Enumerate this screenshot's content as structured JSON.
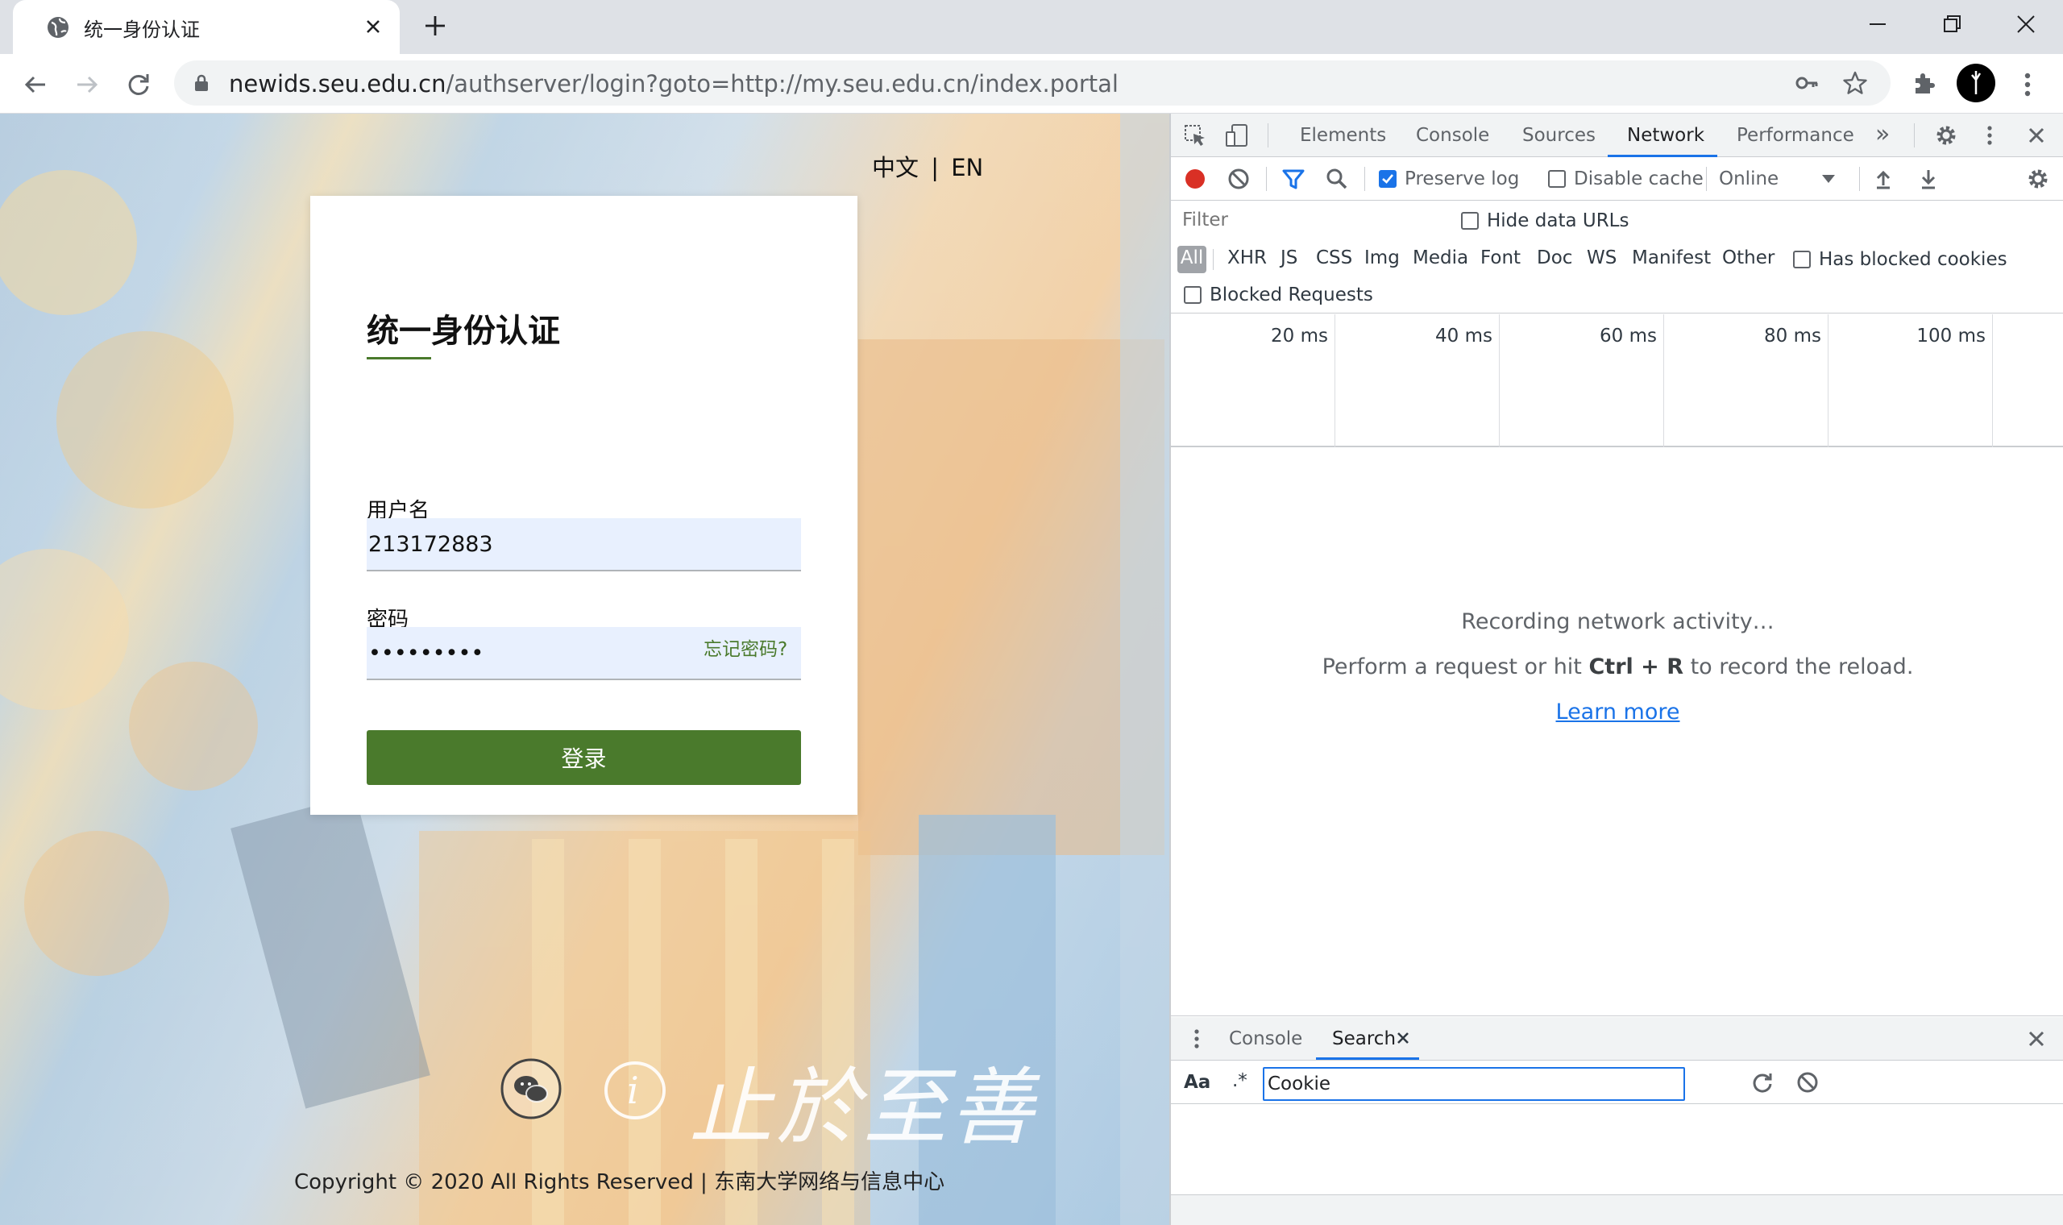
{
  "browser": {
    "tab_title": "统一身份认证",
    "url_host": "newids.seu.edu.cn",
    "url_path": "/authserver/login?goto=http://my.seu.edu.cn/index.portal"
  },
  "page": {
    "lang_zh": "中文",
    "lang_sep": "|",
    "lang_en": "EN",
    "login": {
      "title": "统一身份认证",
      "username_label": "用户名",
      "username_value": "213172883",
      "password_label": "密码",
      "password_value": "•••••••••",
      "forgot": "忘记密码?",
      "submit": "登录"
    },
    "motto": "止於至善",
    "copyright": "Copyright © 2020 All Rights Reserved | 东南大学网络与信息中心"
  },
  "devtools": {
    "tabs": [
      "Elements",
      "Console",
      "Sources",
      "Network",
      "Performance"
    ],
    "active_tab": "Network",
    "more_tabs": "»",
    "toolbar": {
      "preserve_log": "Preserve log",
      "preserve_log_checked": true,
      "disable_cache": "Disable cache",
      "disable_cache_checked": false,
      "throttle": "Online"
    },
    "filter": {
      "placeholder": "Filter",
      "hide_data_urls": "Hide data URLs",
      "types": [
        "All",
        "XHR",
        "JS",
        "CSS",
        "Img",
        "Media",
        "Font",
        "Doc",
        "WS",
        "Manifest",
        "Other"
      ],
      "has_blocked_cookies": "Has blocked cookies",
      "blocked_requests": "Blocked Requests"
    },
    "timeline_ticks": [
      "20 ms",
      "40 ms",
      "60 ms",
      "80 ms",
      "100 ms"
    ],
    "empty_state": {
      "line1": "Recording network activity…",
      "line2_pre": "Perform a request or hit ",
      "line2_keys": "Ctrl + R",
      "line2_post": " to record the reload.",
      "learn_more": "Learn more"
    },
    "drawer": {
      "tabs": [
        "Console",
        "Search"
      ],
      "active_tab": "Search",
      "case_toggle": "Aa",
      "regex_toggle": ".*",
      "search_value": "Cookie"
    }
  },
  "colors": {
    "accent_green": "#4a7a2c",
    "devtools_blue": "#1a73e8",
    "record_red": "#d93025"
  }
}
